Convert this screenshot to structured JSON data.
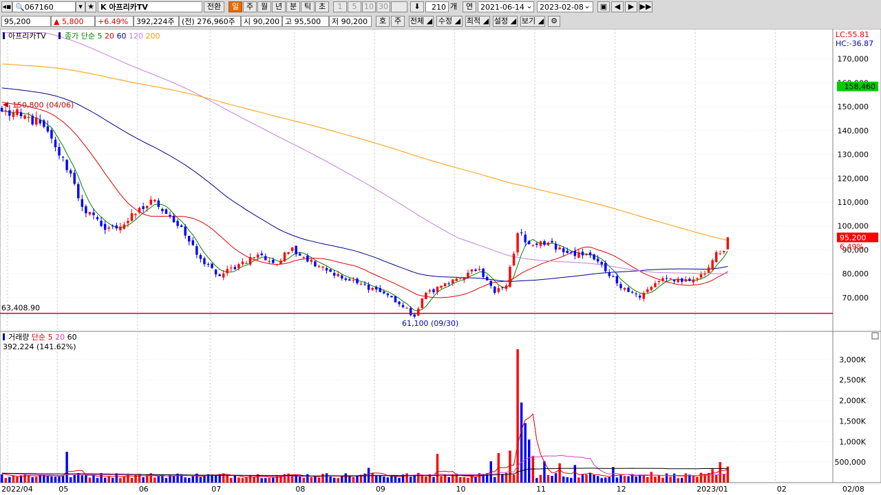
{
  "toolbar": {
    "code": "067160",
    "name": "K 아프리카TV",
    "convert_label": "전환",
    "periods": [
      "일",
      "주",
      "월",
      "년",
      "분",
      "틱",
      "초"
    ],
    "active_period": "일",
    "minute_options": [
      "1",
      "5",
      "10",
      "30"
    ],
    "count": "210",
    "count_unit": "개",
    "date_unit_label": "연",
    "start_date": "2021-06-14",
    "end_date": "2023-02-08"
  },
  "quote": {
    "price": "95,200",
    "change": "▲ 5,800",
    "change_pct": "+6.49%",
    "volume": "392,224주",
    "prev_volume": "(전) 276,960주",
    "open": "시 90,200",
    "high": "고 95,500",
    "low": "저 90,200",
    "buttons": [
      "호",
      "주",
      "전체",
      "수정",
      "최적",
      "설정",
      "보기"
    ]
  },
  "chart_data": {
    "type": "candlestick",
    "price_legend": {
      "name": "아프리카TV",
      "ma_label": "종가 단순",
      "periods": [
        "5",
        "20",
        "60",
        "120",
        "200"
      ],
      "colors": [
        "#008000",
        "#e00000",
        "#00008b",
        "#c080e0",
        "#ff9900"
      ]
    },
    "volume_legend": {
      "name": "거래량",
      "ma_label": "단순",
      "periods": [
        "5",
        "20",
        "60"
      ],
      "colors": [
        "#e00000",
        "#d040d0",
        "#000000"
      ],
      "current": "392,224 (141.62%)"
    },
    "lc_label": "LC:55.81",
    "hc_label": "HC:-36.87",
    "price_ticks": [
      "170,000",
      "160,000",
      "150,000",
      "140,000",
      "130,000",
      "120,000",
      "110,000",
      "100,000",
      "90,000",
      "80,000",
      "70,000"
    ],
    "price_range": [
      57000,
      182000
    ],
    "volume_ticks": [
      "3,000K",
      "2,500K",
      "2,000K",
      "1,500K",
      "1,000K",
      "500,000"
    ],
    "volume_range": [
      0,
      3550000
    ],
    "x_labels": [
      "2022/04",
      "05",
      "06",
      "07",
      "08",
      "09",
      "10",
      "11",
      "12",
      "2023/01",
      "02",
      "02/08"
    ],
    "markers": {
      "high": "150,800 (04/06)",
      "low": "61,100 (09/30)",
      "support": "63,408.90",
      "support_value": 63408.9,
      "last_price": "95,200",
      "last_pct": "6.49%",
      "ma_label": "158,460",
      "ma_value": 158460
    },
    "anchors": [
      {
        "i": 0,
        "c": 148000
      },
      {
        "i": 5,
        "c": 146000
      },
      {
        "i": 10,
        "c": 143000
      },
      {
        "i": 14,
        "c": 133000
      },
      {
        "i": 18,
        "c": 122000
      },
      {
        "i": 21,
        "c": 108000
      },
      {
        "i": 26,
        "c": 100000
      },
      {
        "i": 30,
        "c": 99000
      },
      {
        "i": 35,
        "c": 105000
      },
      {
        "i": 40,
        "c": 111000
      },
      {
        "i": 44,
        "c": 104000
      },
      {
        "i": 48,
        "c": 96000
      },
      {
        "i": 53,
        "c": 84000
      },
      {
        "i": 57,
        "c": 79000
      },
      {
        "i": 62,
        "c": 84000
      },
      {
        "i": 67,
        "c": 88000
      },
      {
        "i": 72,
        "c": 84000
      },
      {
        "i": 76,
        "c": 91000
      },
      {
        "i": 79,
        "c": 87000
      },
      {
        "i": 84,
        "c": 83000
      },
      {
        "i": 89,
        "c": 78000
      },
      {
        "i": 93,
        "c": 76000
      },
      {
        "i": 97,
        "c": 74000
      },
      {
        "i": 101,
        "c": 71000
      },
      {
        "i": 105,
        "c": 66000
      },
      {
        "i": 108,
        "c": 62000
      },
      {
        "i": 111,
        "c": 72000
      },
      {
        "i": 115,
        "c": 75000
      },
      {
        "i": 120,
        "c": 78000
      },
      {
        "i": 125,
        "c": 82000
      },
      {
        "i": 129,
        "c": 72000
      },
      {
        "i": 132,
        "c": 75000
      },
      {
        "i": 135,
        "c": 97000
      },
      {
        "i": 139,
        "c": 92000
      },
      {
        "i": 143,
        "c": 93000
      },
      {
        "i": 147,
        "c": 89000
      },
      {
        "i": 151,
        "c": 89000
      },
      {
        "i": 155,
        "c": 86000
      },
      {
        "i": 159,
        "c": 79000
      },
      {
        "i": 163,
        "c": 74000
      },
      {
        "i": 167,
        "c": 70000
      },
      {
        "i": 171,
        "c": 76000
      },
      {
        "i": 175,
        "c": 78000
      },
      {
        "i": 180,
        "c": 77000
      },
      {
        "i": 184,
        "c": 80000
      },
      {
        "i": 187,
        "c": 89000
      },
      {
        "i": 189,
        "c": 89500
      },
      {
        "i": 190,
        "c": 95200
      }
    ],
    "volume_spikes": [
      {
        "i": 17,
        "v": 750000
      },
      {
        "i": 96,
        "v": 360000
      },
      {
        "i": 114,
        "v": 700000
      },
      {
        "i": 128,
        "v": 520000
      },
      {
        "i": 130,
        "v": 720000
      },
      {
        "i": 133,
        "v": 780000
      },
      {
        "i": 135,
        "v": 3250000
      },
      {
        "i": 136,
        "v": 1950000
      },
      {
        "i": 137,
        "v": 1450000
      },
      {
        "i": 138,
        "v": 1050000
      },
      {
        "i": 139,
        "v": 650000
      },
      {
        "i": 142,
        "v": 520000
      },
      {
        "i": 146,
        "v": 470000
      },
      {
        "i": 150,
        "v": 430000
      },
      {
        "i": 160,
        "v": 380000
      },
      {
        "i": 170,
        "v": 260000
      },
      {
        "i": 186,
        "v": 330000
      },
      {
        "i": 188,
        "v": 500000
      },
      {
        "i": 190,
        "v": 392224
      }
    ]
  }
}
